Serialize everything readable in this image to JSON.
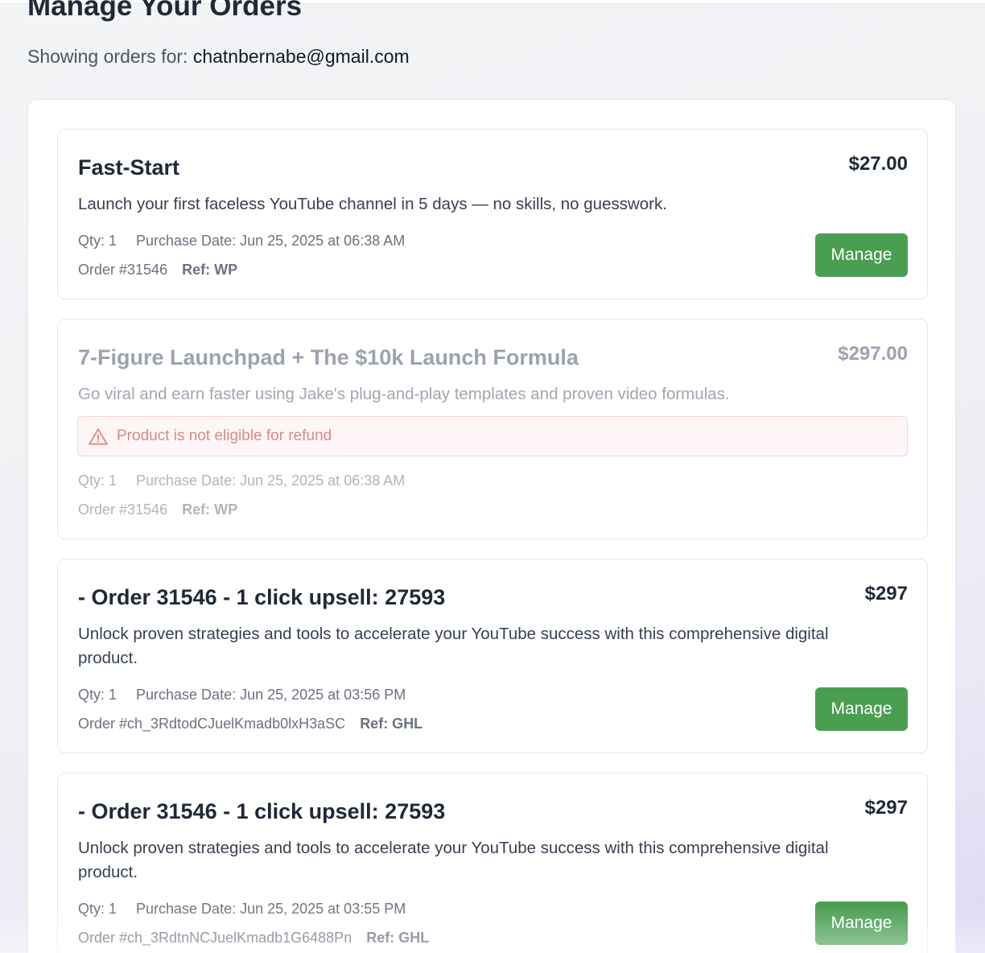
{
  "page": {
    "title": "Manage Your Orders",
    "subtitle_prefix": "Showing orders for:",
    "email": "chatnbernabe@gmail.com"
  },
  "orders": [
    {
      "title": "Fast-Start",
      "price": "$27.00",
      "description": "Launch your first faceless YouTube channel in 5 days — no skills, no guesswork.",
      "qty": "Qty: 1",
      "purchase_date": "Purchase Date: Jun 25, 2025 at 06:38 AM",
      "order_number": "Order #31546",
      "ref": "Ref: WP",
      "button_label": "Manage",
      "status": "active"
    },
    {
      "title": "7-Figure Launchpad + The $10k Launch Formula",
      "price": "$297.00",
      "description": "Go viral and earn faster using Jake's plug-and-play templates and proven video formulas.",
      "notice": "Product is not eligible for refund",
      "qty": "Qty: 1",
      "purchase_date": "Purchase Date: Jun 25, 2025 at 06:38 AM",
      "order_number": "Order #31546",
      "ref": "Ref: WP",
      "status": "not-eligible"
    },
    {
      "title": "- Order 31546 - 1 click upsell: 27593",
      "price": "$297",
      "description": "Unlock proven strategies and tools to accelerate your YouTube success with this comprehensive digital product.",
      "qty": "Qty: 1",
      "purchase_date": "Purchase Date: Jun 25, 2025 at 03:56 PM",
      "order_number": "Order #ch_3RdtodCJuelKmadb0lxH3aSC",
      "ref": "Ref: GHL",
      "button_label": "Manage",
      "status": "active"
    },
    {
      "title": "- Order 31546 - 1 click upsell: 27593",
      "price": "$297",
      "description": "Unlock proven strategies and tools to accelerate your YouTube success with this comprehensive digital product.",
      "qty": "Qty: 1",
      "purchase_date": "Purchase Date: Jun 25, 2025 at 03:55 PM",
      "order_number": "Order #ch_3RdtnNCJuelKmadb1G6488Pn",
      "ref": "Ref: GHL",
      "button_label": "Manage",
      "status": "active"
    }
  ],
  "colors": {
    "manage_button": "#4a9e52",
    "refund_notice_text": "#d98a8a",
    "refund_notice_bg": "#fef6f6"
  },
  "icons": {
    "refund_notice": "warning-triangle-icon"
  }
}
